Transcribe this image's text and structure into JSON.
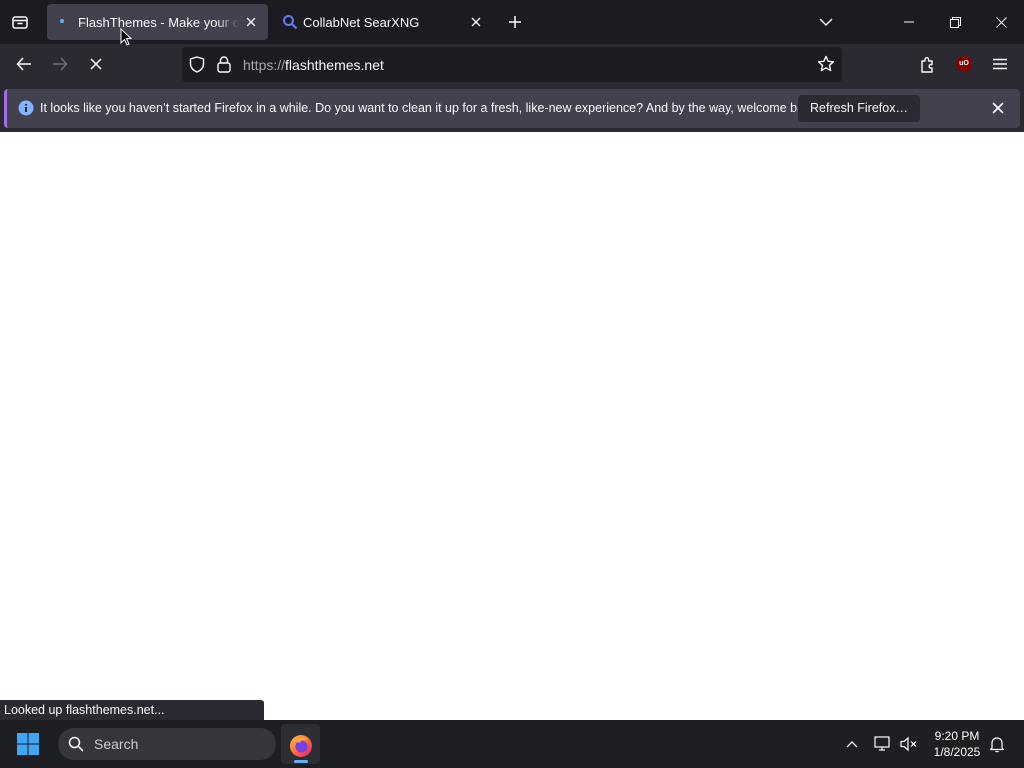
{
  "browser": {
    "tabs": [
      {
        "title": "FlashThemes - Make your own animations!",
        "active": true
      },
      {
        "title": "CollabNet SearXNG",
        "active": false
      }
    ],
    "url": {
      "scheme": "https://",
      "host": "flashthemes.net"
    },
    "notification": {
      "message": "It looks like you haven’t started Firefox in a while. Do you want to clean it up for a fresh, like-new experience? And by the way, welcome back!",
      "button_label": "Refresh Firefox…"
    },
    "status_text": "Looked up flashthemes.net...",
    "extension_badge": "uO"
  },
  "taskbar": {
    "search_label": "Search",
    "time": "9:20 PM",
    "date": "1/8/2025"
  },
  "colors": {
    "accent": "#a56de8",
    "info": "#80b5ff",
    "chrome_dark": "#1c1b22",
    "chrome": "#2b2a33",
    "tab_active": "#42414d"
  },
  "icons": [
    "firefox-view-icon",
    "search-engine-icon",
    "new-tab-icon",
    "list-all-tabs-icon",
    "minimize-icon",
    "restore-icon",
    "close-icon",
    "back-icon",
    "forward-icon",
    "stop-icon",
    "tracking-shield-icon",
    "lock-icon",
    "bookmark-star-icon",
    "extensions-icon",
    "ublock-icon",
    "menu-icon",
    "info-icon",
    "windows-start-icon",
    "firefox-icon",
    "chevron-up-icon",
    "network-icon",
    "volume-muted-icon",
    "notification-bell-icon"
  ]
}
